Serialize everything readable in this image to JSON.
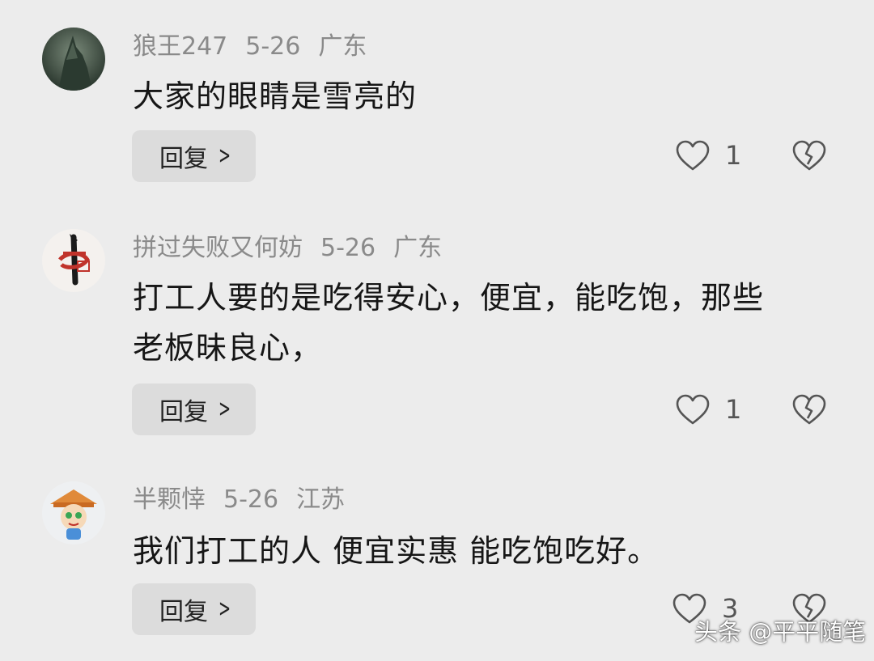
{
  "comments": [
    {
      "username": "狼王247",
      "date": "5-26",
      "location": "广东",
      "text": "大家的眼睛是雪亮的",
      "reply_label": "回复",
      "likes": "1"
    },
    {
      "username": "拼过失败又何妨",
      "date": "5-26",
      "location": "广东",
      "text": "打工人要的是吃得安心，便宜，能吃饱，那些老板昧良心，",
      "reply_label": "回复",
      "likes": "1"
    },
    {
      "username": "半颗悻",
      "date": "5-26",
      "location": "江苏",
      "text": "我们打工的人 便宜实惠 能吃饱吃好。",
      "reply_label": "回复",
      "likes": "3"
    }
  ],
  "watermark": "头条 @平平随笔",
  "icons": {
    "like": "heart-outline-icon",
    "dislike": "broken-heart-icon",
    "reply_chevron": "chevron-right-icon"
  },
  "colors": {
    "background": "#ececec",
    "meta_text": "#8a8a8a",
    "reply_button_bg": "#dcdcdc"
  }
}
